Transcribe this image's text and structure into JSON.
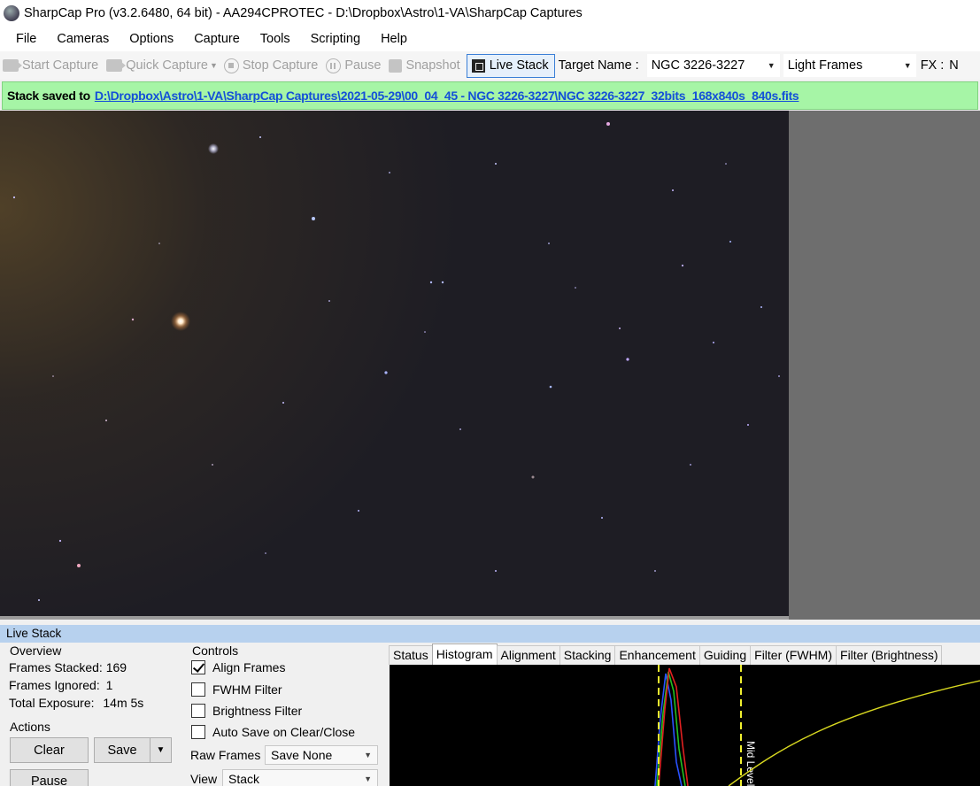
{
  "window": {
    "title": "SharpCap Pro (v3.2.6480, 64 bit) - AA294CPROTEC - D:\\Dropbox\\Astro\\1-VA\\SharpCap Captures"
  },
  "menu": [
    "File",
    "Cameras",
    "Options",
    "Capture",
    "Tools",
    "Scripting",
    "Help"
  ],
  "toolbar": {
    "start_capture": "Start Capture",
    "quick_capture": "Quick Capture",
    "stop_capture": "Stop Capture",
    "pause": "Pause",
    "snapshot": "Snapshot",
    "live_stack": "Live Stack",
    "target_name_label": "Target Name :",
    "target_name_value": "NGC 3226-3227",
    "frame_type": "Light Frames",
    "fx_label": "FX :",
    "fx_value": "N"
  },
  "status": {
    "prefix": "Stack saved to",
    "link": "D:\\Dropbox\\Astro\\1-VA\\SharpCap Captures\\2021-05-29\\00_04_45 - NGC 3226-3227\\NGC 3226-3227_32bits_168x840s_840s.fits",
    "color": "#a6f5a6"
  },
  "live_stack": {
    "panel_title": "Live Stack",
    "overview": {
      "title": "Overview",
      "frames_stacked_label": "Frames Stacked:",
      "frames_stacked": "169",
      "frames_ignored_label": "Frames Ignored:",
      "frames_ignored": "1",
      "total_exposure_label": "Total Exposure:",
      "total_exposure": "14m 5s"
    },
    "actions": {
      "title": "Actions",
      "clear": "Clear",
      "save": "Save",
      "pause": "Pause"
    },
    "controls": {
      "title": "Controls",
      "align_frames": "Align Frames",
      "align_frames_checked": true,
      "fwhm_filter": "FWHM Filter",
      "fwhm_filter_checked": false,
      "brightness_filter": "Brightness Filter",
      "brightness_filter_checked": false,
      "auto_save": "Auto Save on Clear/Close",
      "auto_save_checked": false,
      "raw_frames_label": "Raw Frames",
      "raw_frames_value": "Save None",
      "view_label": "View",
      "view_value": "Stack"
    },
    "tabs": [
      "Status",
      "Histogram",
      "Alignment",
      "Stacking",
      "Enhancement",
      "Guiding",
      "Filter (FWHM)",
      "Filter (Brightness)"
    ],
    "active_tab": "Histogram",
    "histogram": {
      "mid_level_label": "Mid Level"
    }
  }
}
